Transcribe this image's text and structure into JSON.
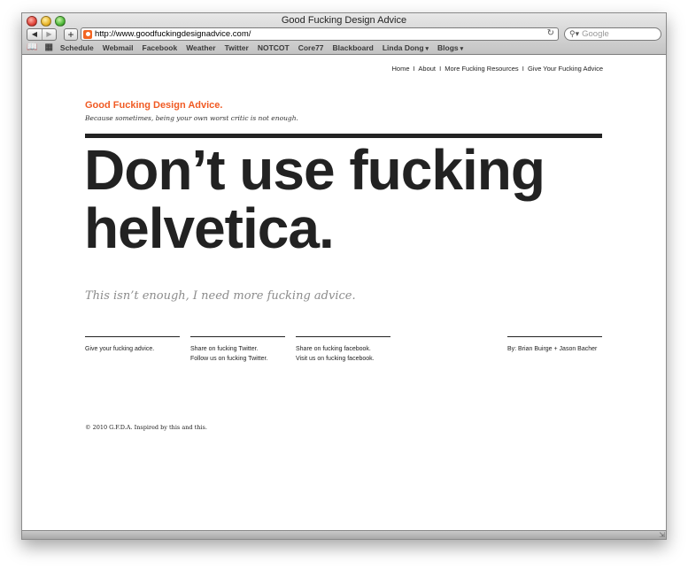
{
  "window": {
    "title": "Good Fucking Design Advice"
  },
  "toolbar": {
    "back_icon": "◀",
    "forward_icon": "▶",
    "add_icon": "+",
    "url": "http://www.goodfuckingdesignadvice.com/",
    "reload_icon": "↻",
    "search_placeholder": "Google"
  },
  "bookmarks": [
    "Schedule",
    "Webmail",
    "Facebook",
    "Weather",
    "Twitter",
    "NOTCOT",
    "Core77",
    "Blackboard",
    "Linda Dong",
    "Blogs"
  ],
  "page": {
    "topnav": [
      "Home",
      "About",
      "More Fucking Resources",
      "Give Your Fucking Advice"
    ],
    "topnav_sep": "I",
    "site_title": "Good Fucking Design Advice.",
    "tagline": "Because sometimes, being your own worst critic is not enough.",
    "advice": "Don’t use fucking helvetica.",
    "more_link": "This isn’t enough, I need more fucking advice.",
    "columns": {
      "c1": [
        "Give your fucking advice."
      ],
      "c2": [
        "Share on fucking Twitter.",
        "Follow us on fucking Twitter."
      ],
      "c3": [
        "Share on fucking facebook.",
        "Visit us on fucking facebook."
      ],
      "c4": [
        "By: Brian Buirge + Jason Bacher"
      ]
    },
    "footer": "© 2010 G.F.D.A. Inspired by this and this."
  },
  "colors": {
    "accent": "#f05a23",
    "text": "#222222",
    "muted": "#8c8c8c"
  }
}
